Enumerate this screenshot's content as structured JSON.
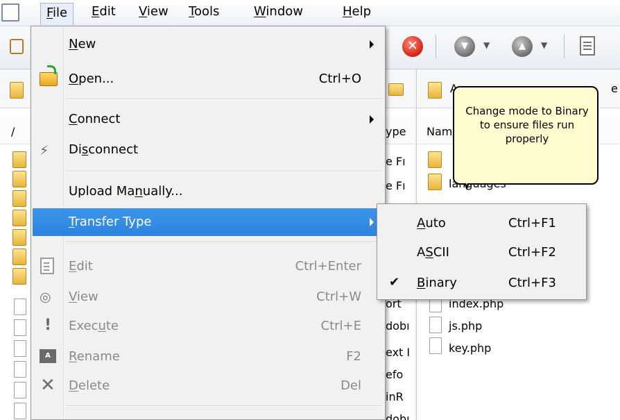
{
  "menubar": {
    "items": [
      {
        "label": "File",
        "mnemonic": "F",
        "rest": "ile"
      },
      {
        "label": "Edit",
        "mnemonic": "E",
        "rest": "dit"
      },
      {
        "label": "View",
        "mnemonic": "V",
        "rest": "iew"
      },
      {
        "label": "Tools",
        "mnemonic": "T",
        "rest": "ools"
      },
      {
        "label": "Window",
        "mnemonic": "W",
        "rest": "indow"
      },
      {
        "label": "Help",
        "mnemonic": "H",
        "rest": "elp"
      }
    ]
  },
  "file_menu": {
    "items": [
      {
        "label": "New",
        "mnemonic": "N",
        "pre": "",
        "post": "ew",
        "shortcut": "",
        "submenu": true,
        "enabled": true,
        "icon": ""
      },
      {
        "label": "Open...",
        "mnemonic": "O",
        "pre": "",
        "post": "pen...",
        "shortcut": "Ctrl+O",
        "submenu": false,
        "enabled": true,
        "icon": "open-folder-icon"
      },
      {
        "label": "Connect",
        "mnemonic": "C",
        "pre": "",
        "post": "onnect",
        "shortcut": "",
        "submenu": true,
        "enabled": true,
        "icon": ""
      },
      {
        "label": "Disconnect",
        "mnemonic": "s",
        "pre": "Di",
        "post": "connect",
        "shortcut": "",
        "submenu": false,
        "enabled": true,
        "icon": "disconnect-icon"
      },
      {
        "label": "Upload Manually...",
        "mnemonic": "n",
        "pre": "Upload Ma",
        "post": "ually...",
        "shortcut": "",
        "submenu": false,
        "enabled": true,
        "icon": ""
      },
      {
        "label": "Transfer Type",
        "mnemonic": "T",
        "pre": "",
        "post": "ransfer Type",
        "shortcut": "",
        "submenu": true,
        "enabled": true,
        "icon": ""
      },
      {
        "label": "Edit",
        "mnemonic": "E",
        "pre": "",
        "post": "dit",
        "shortcut": "Ctrl+Enter",
        "submenu": false,
        "enabled": false,
        "icon": "edit-icon"
      },
      {
        "label": "View",
        "mnemonic": "V",
        "pre": "",
        "post": "iew",
        "shortcut": "Ctrl+W",
        "submenu": false,
        "enabled": false,
        "icon": "view-icon"
      },
      {
        "label": "Execute",
        "mnemonic": "u",
        "pre": "Exec",
        "post": "te",
        "shortcut": "Ctrl+E",
        "submenu": false,
        "enabled": false,
        "icon": "execute-icon"
      },
      {
        "label": "Rename",
        "mnemonic": "R",
        "pre": "",
        "post": "ename",
        "shortcut": "F2",
        "submenu": false,
        "enabled": false,
        "icon": "rename-icon"
      },
      {
        "label": "Delete",
        "mnemonic": "D",
        "pre": "",
        "post": "elete",
        "shortcut": "Del",
        "submenu": false,
        "enabled": false,
        "icon": "delete-icon"
      }
    ]
  },
  "transfer_submenu": {
    "items": [
      {
        "label": "Auto",
        "mnemonic": "A",
        "pre": "",
        "post": "uto",
        "shortcut": "Ctrl+F1",
        "checked": false
      },
      {
        "label": "ASCII",
        "mnemonic": "S",
        "pre": "A",
        "post": "CII",
        "shortcut": "Ctrl+F2",
        "checked": false
      },
      {
        "label": "Binary",
        "mnemonic": "B",
        "pre": "",
        "post": "inary",
        "shortcut": "Ctrl+F3",
        "checked": true
      }
    ]
  },
  "tooltip": {
    "text": "Change mode to Binary to ensure files run properly"
  },
  "left_panel": {
    "path_root": "/",
    "column_fragment": "ype",
    "cell_fragments": [
      "e Fı",
      "e Fı",
      "ort",
      "dobı",
      "ext I",
      "efo",
      "inR",
      "dobı"
    ]
  },
  "right_panel": {
    "column_name": "Nam",
    "path_fragment": "A",
    "path_suffix": "e",
    "files": [
      {
        "name": "languages",
        "type": "folder"
      },
      {
        "name": "index.php",
        "type": "file"
      },
      {
        "name": "js.php",
        "type": "file"
      },
      {
        "name": "key.php",
        "type": "file"
      }
    ]
  },
  "colors": {
    "menu_bg": "#f1f1f1",
    "highlight": "#3391e6",
    "disabled_text": "#8a8a8a",
    "tooltip_bg": "#fffdcf",
    "stop_red": "#d8281a"
  }
}
